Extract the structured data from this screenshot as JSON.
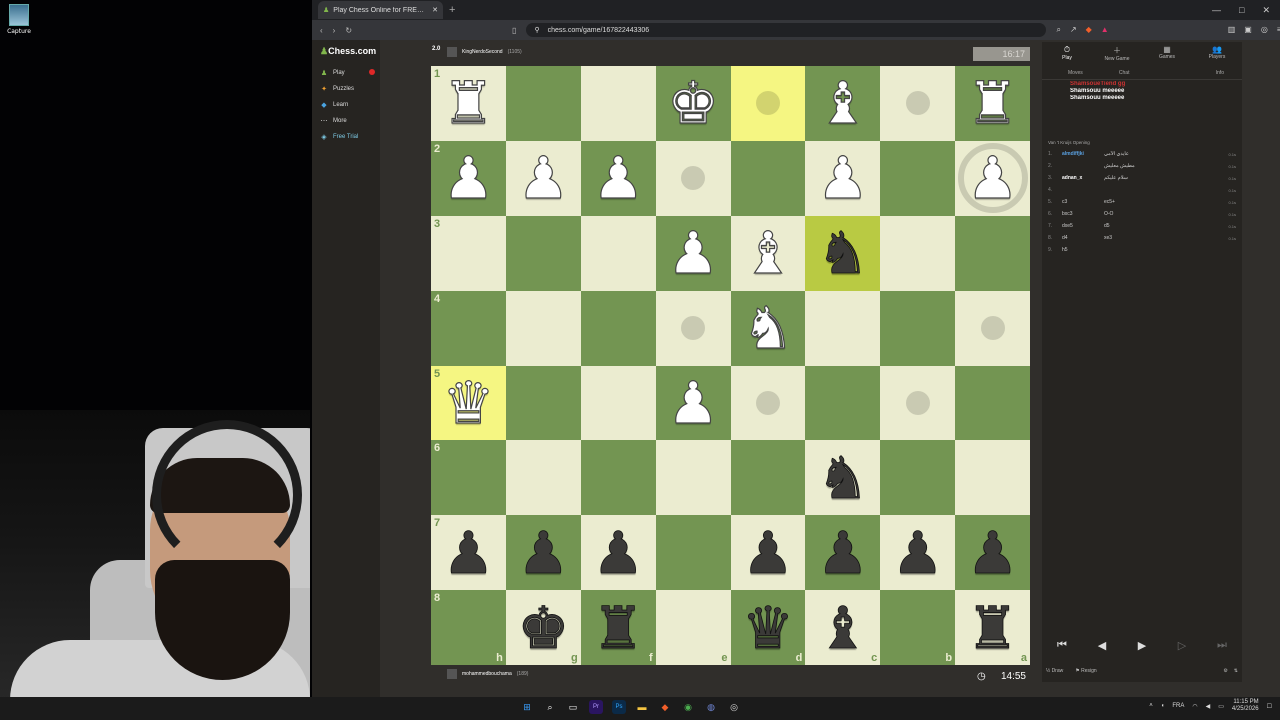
{
  "desktop": {
    "icon_label": "Capture"
  },
  "browser": {
    "tab_title": "Play Chess Online for FREE - 2 P",
    "url": "chess.com/game/167822443306",
    "window_controls": [
      "—",
      "□",
      "✕"
    ]
  },
  "site": {
    "logo_text": "Chess",
    "logo_suffix": ".com",
    "nav": [
      {
        "label": "Play",
        "icon": "♟"
      },
      {
        "label": "Puzzles",
        "icon": "✦"
      },
      {
        "label": "Learn",
        "icon": "◆"
      },
      {
        "label": "More",
        "icon": "⋯"
      },
      {
        "label": "Free Trial",
        "icon": "◈"
      }
    ]
  },
  "game": {
    "eval": "2.0",
    "top_player": {
      "name": "KingNerdoSecond",
      "rating": "(1105)",
      "clock": "16:17"
    },
    "bottom_player": {
      "name": "mohammedbouchama",
      "rating": "(189)",
      "clock": "14:55"
    },
    "board_orientation": "black",
    "ranks": [
      "1",
      "2",
      "3",
      "4",
      "5",
      "6",
      "7",
      "8"
    ],
    "files": [
      "h",
      "g",
      "f",
      "e",
      "d",
      "c",
      "b",
      "a"
    ],
    "board": [
      [
        "wR",
        "",
        "",
        "wK",
        "",
        "wB",
        "",
        "wR"
      ],
      [
        "wP",
        "wP",
        "wP",
        "",
        "",
        "wP",
        "",
        "wP"
      ],
      [
        "",
        "",
        "",
        "wP",
        "wB",
        "bN",
        "",
        ""
      ],
      [
        "",
        "",
        "",
        "",
        "wN",
        "",
        "",
        ""
      ],
      [
        "wQ",
        "",
        "",
        "wP",
        "",
        "",
        "",
        ""
      ],
      [
        "",
        "",
        "",
        "",
        "",
        "bN",
        "",
        ""
      ],
      [
        "bP",
        "bP",
        "bP",
        "",
        "bP",
        "bP",
        "bP",
        "bP"
      ],
      [
        "",
        "bK",
        "bR",
        "",
        "bQ",
        "bB",
        "",
        "bR"
      ]
    ],
    "highlights": [
      "0-4",
      "2-5",
      "4-0"
    ],
    "dots": [
      "0-4",
      "0-6",
      "1-3",
      "3-3",
      "3-7",
      "4-4",
      "4-6"
    ],
    "rings": [
      "1-7"
    ]
  },
  "panel": {
    "tabs": [
      {
        "label": "Play",
        "icon": "⏱"
      },
      {
        "label": "New Game",
        "icon": "＋"
      },
      {
        "label": "Games",
        "icon": "▦"
      },
      {
        "label": "Players",
        "icon": "👥"
      }
    ],
    "subtabs": [
      "Moves",
      "Chat",
      "Info"
    ],
    "chat": [
      {
        "text": "ShamsoueTiend gg",
        "red": true
      },
      {
        "text": "Shamsouu meeeee",
        "red": false
      },
      {
        "text": "Shamsouu meeeee",
        "red": false
      }
    ],
    "opening": "Van 't Kruijs Opening",
    "moves": [
      {
        "n": "1.",
        "w": "almdiffjki",
        "b": "عايدي الأمي",
        "tm": "0.1s",
        "wc": "blue"
      },
      {
        "n": "2.",
        "w": "",
        "b": "مطيش معليش",
        "tm": "0.1s",
        "wc": "red"
      },
      {
        "n": "3.",
        "w": "adnan_x",
        "b": "سلام عليكم",
        "tm": "0.1s",
        "wc": "white"
      },
      {
        "n": "4.",
        "w": "",
        "b": "",
        "tm": "0.1s",
        "wc": "blue"
      },
      {
        "n": "5.",
        "w": "c3",
        "b": "ec5+",
        "tm": "0.1s",
        "wc": "none"
      },
      {
        "n": "6.",
        "w": "bxc3",
        "b": "O-O",
        "tm": "0.1s",
        "wc": "none"
      },
      {
        "n": "7.",
        "w": "dxe5",
        "b": "d5",
        "tm": "0.1s",
        "wc": "none"
      },
      {
        "n": "8.",
        "w": "d4",
        "b": "xe3",
        "tm": "0.1s",
        "wc": "none"
      },
      {
        "n": "9.",
        "w": "h5",
        "b": "",
        "tm": "",
        "wc": "none"
      }
    ],
    "nav_buttons": [
      "⏮",
      "◀",
      "▶",
      "▷",
      "⏭"
    ],
    "actions": {
      "draw": "Draw",
      "resign": "Resign"
    }
  },
  "taskbar": {
    "language": "FRA",
    "time": "11:15 PM",
    "date": "4/25/2026"
  }
}
